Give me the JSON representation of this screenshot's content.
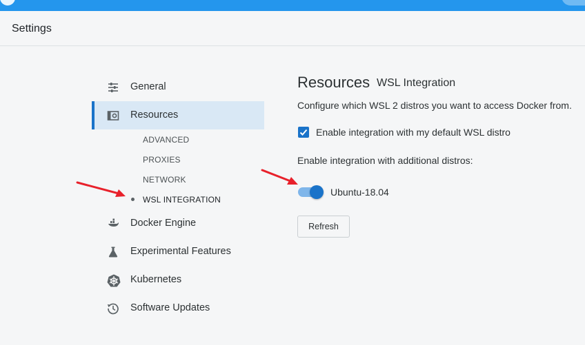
{
  "header": {
    "title": "Settings"
  },
  "sidebar": {
    "items": [
      {
        "label": "General",
        "icon": "sliders-icon"
      },
      {
        "label": "Resources",
        "icon": "resources-icon"
      },
      {
        "label": "Docker Engine",
        "icon": "whale-icon"
      },
      {
        "label": "Experimental Features",
        "icon": "flask-icon"
      },
      {
        "label": "Kubernetes",
        "icon": "helm-icon"
      },
      {
        "label": "Software Updates",
        "icon": "history-icon"
      }
    ],
    "subitems": [
      "ADVANCED",
      "PROXIES",
      "NETWORK",
      "WSL INTEGRATION"
    ],
    "active_item": "Resources",
    "active_subitem": "WSL INTEGRATION"
  },
  "content": {
    "title": "Resources",
    "subtitle": "WSL Integration",
    "description": "Configure which WSL 2 distros you want to access Docker from.",
    "default_distro_label": "Enable integration with my default WSL distro",
    "default_distro_checked": true,
    "additional_label": "Enable integration with additional distros:",
    "distros": [
      {
        "name": "Ubuntu-18.04",
        "enabled": true
      }
    ],
    "refresh_label": "Refresh"
  },
  "colors": {
    "accent": "#1a73c9",
    "titlebar": "#2496ed",
    "annotation_arrow": "#e8212b"
  }
}
